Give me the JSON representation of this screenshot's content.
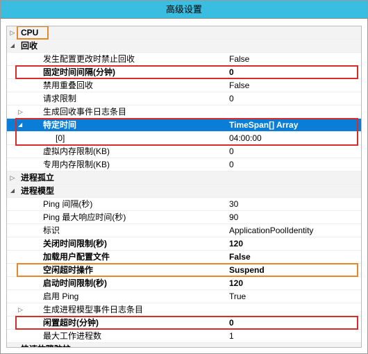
{
  "window": {
    "title": "高级设置"
  },
  "sections": {
    "cpu": {
      "label": "CPU"
    },
    "recycle": {
      "label": "回收",
      "r1_label": "发生配置更改时禁止回收",
      "r1_value": "False",
      "r2_label": "固定时间间隔(分钟)",
      "r2_value": "0",
      "r3_label": "禁用重叠回收",
      "r3_value": "False",
      "r4_label": "请求限制",
      "r4_value": "0",
      "r5_label": "生成回收事件日志条目"
    },
    "specific": {
      "label": "特定时间",
      "value": "TimeSpan[] Array",
      "item0_label": "[0]",
      "item0_value": "04:00:00",
      "vm_label": "虚拟内存限制(KB)",
      "vm_value": "0",
      "pm_label": "专用内存限制(KB)",
      "pm_value": "0"
    },
    "iso": {
      "label": "进程孤立"
    },
    "model": {
      "label": "进程模型",
      "m1_label": "Ping 间隔(秒)",
      "m1_value": "30",
      "m2_label": "Ping 最大响应时间(秒)",
      "m2_value": "90",
      "m3_label": "标识",
      "m3_value": "ApplicationPoolIdentity",
      "m4_label": "关闭时间限制(秒)",
      "m4_value": "120",
      "m5_label": "加载用户配置文件",
      "m5_value": "False",
      "m6_label": "空闲超时操作",
      "m6_value": "Suspend",
      "m7_label": "启动时间限制(秒)",
      "m7_value": "120",
      "m8_label": "启用 Ping",
      "m8_value": "True",
      "m9_label": "生成进程模型事件日志条目",
      "m10_label": "闲置超时(分钟)",
      "m10_value": "0",
      "m11_label": "最大工作进程数",
      "m11_value": "1",
      "m12_label": "快速故障防护"
    }
  }
}
